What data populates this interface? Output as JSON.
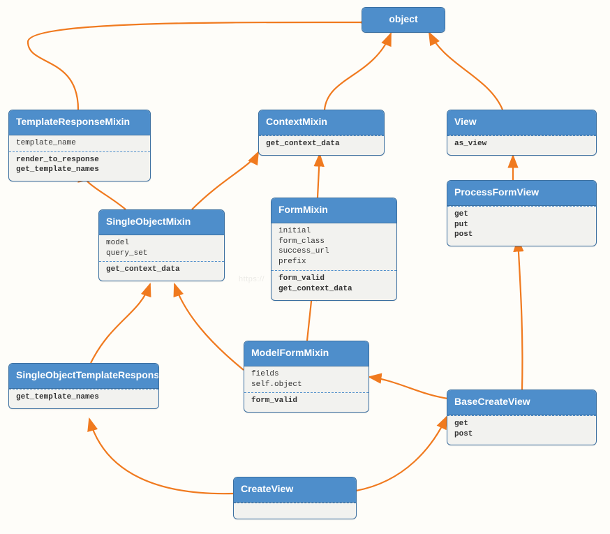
{
  "diagram": {
    "root": {
      "title": "object"
    },
    "templateResponseMixin": {
      "title": "TemplateResponseMixin",
      "attrs": "template_name",
      "methods": "render_to_response\nget_template_names"
    },
    "contextMixin": {
      "title": "ContextMixin",
      "methods": "get_context_data"
    },
    "view": {
      "title": "View",
      "methods": "as_view"
    },
    "processFormView": {
      "title": "ProcessFormView",
      "methods": "get\nput\npost"
    },
    "singleObjectMixin": {
      "title": "SingleObjectMixin",
      "attrs": "model\nquery_set",
      "methods": "get_context_data"
    },
    "formMixin": {
      "title": "FormMixin",
      "attrs": "initial\nform_class\nsuccess_url\nprefix",
      "methods": "form_valid\nget_context_data"
    },
    "singleObjectTemplateResponseMixin": {
      "title": "SingleObjectTemplateResponseMixin",
      "methods": "get_template_names"
    },
    "modelFormMixin": {
      "title": "ModelFormMixin",
      "attrs": "fields\nself.object",
      "methods": "form_valid"
    },
    "baseCreateView": {
      "title": "BaseCreateView",
      "methods": "get\npost"
    },
    "createView": {
      "title": "CreateView"
    }
  },
  "watermark": "https://"
}
